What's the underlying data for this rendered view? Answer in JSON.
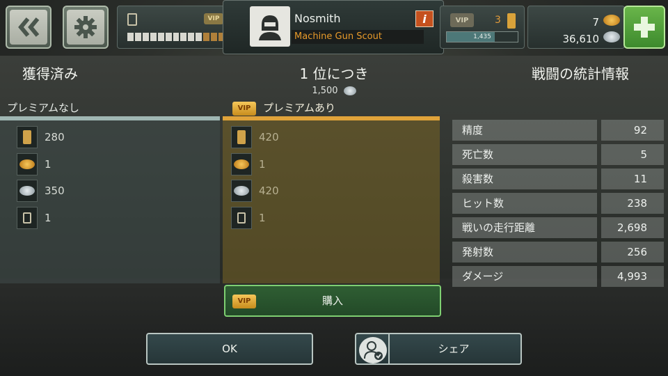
{
  "top_bar": {
    "player": {
      "name": "Nosmith",
      "class": "Machine Gun Scout",
      "info_glyph": "i"
    },
    "fuel": {
      "vip_label": "VIP",
      "segments_filled": 10,
      "segments_total": 13
    },
    "rank": {
      "vip_label": "VIP",
      "value": "3",
      "xp": "1,435",
      "xp_fraction": 0.68
    },
    "currency": {
      "gold": "7",
      "silver": "36,610"
    }
  },
  "headings": {
    "acquired": "獲得済み",
    "per_place": "1 位につき",
    "battle_stats": "戦闘の統計情報"
  },
  "per_place_reward": "1,500",
  "columns": {
    "no_premium": {
      "label": "プレミアムなし",
      "rewards": [
        {
          "icon": "rank-icon",
          "value": "280"
        },
        {
          "icon": "gold-coin-icon",
          "value": "1"
        },
        {
          "icon": "silver-coin-icon",
          "value": "350"
        },
        {
          "icon": "fuel-icon",
          "value": "1"
        }
      ]
    },
    "premium": {
      "vip_label": "VIP",
      "label": "プレミアムあり",
      "rewards": [
        {
          "icon": "rank-icon",
          "value": "420"
        },
        {
          "icon": "gold-coin-icon",
          "value": "1"
        },
        {
          "icon": "silver-coin-icon",
          "value": "420"
        },
        {
          "icon": "fuel-icon",
          "value": "1"
        }
      ]
    }
  },
  "stats": [
    {
      "label": "精度",
      "value": "92"
    },
    {
      "label": "死亡数",
      "value": "5"
    },
    {
      "label": "殺害数",
      "value": "11"
    },
    {
      "label": "ヒット数",
      "value": "238"
    },
    {
      "label": "戦いの走行距離",
      "value": "2,698"
    },
    {
      "label": "発射数",
      "value": "256"
    },
    {
      "label": "ダメージ",
      "value": "4,993"
    }
  ],
  "buttons": {
    "buy": "購入",
    "buy_vip": "VIP",
    "ok": "OK",
    "share": "シェア"
  },
  "colors": {
    "premium_accent": "#e0a33a",
    "buy_border": "#7fd072",
    "class_text": "#e89a2a"
  }
}
